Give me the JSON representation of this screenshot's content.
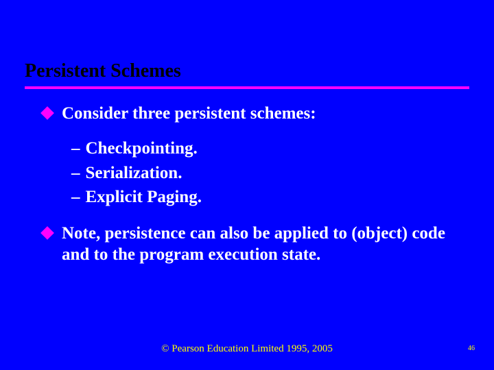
{
  "title": "Persistent Schemes",
  "bullets": [
    {
      "text": "Consider three persistent schemes:"
    },
    {
      "text": "Note, persistence can also be applied to (object) code and to the program execution state."
    }
  ],
  "sublist": [
    "Checkpointing.",
    "Serialization.",
    "Explicit Paging."
  ],
  "footer": "© Pearson Education Limited 1995, 2005",
  "page_number": "46"
}
